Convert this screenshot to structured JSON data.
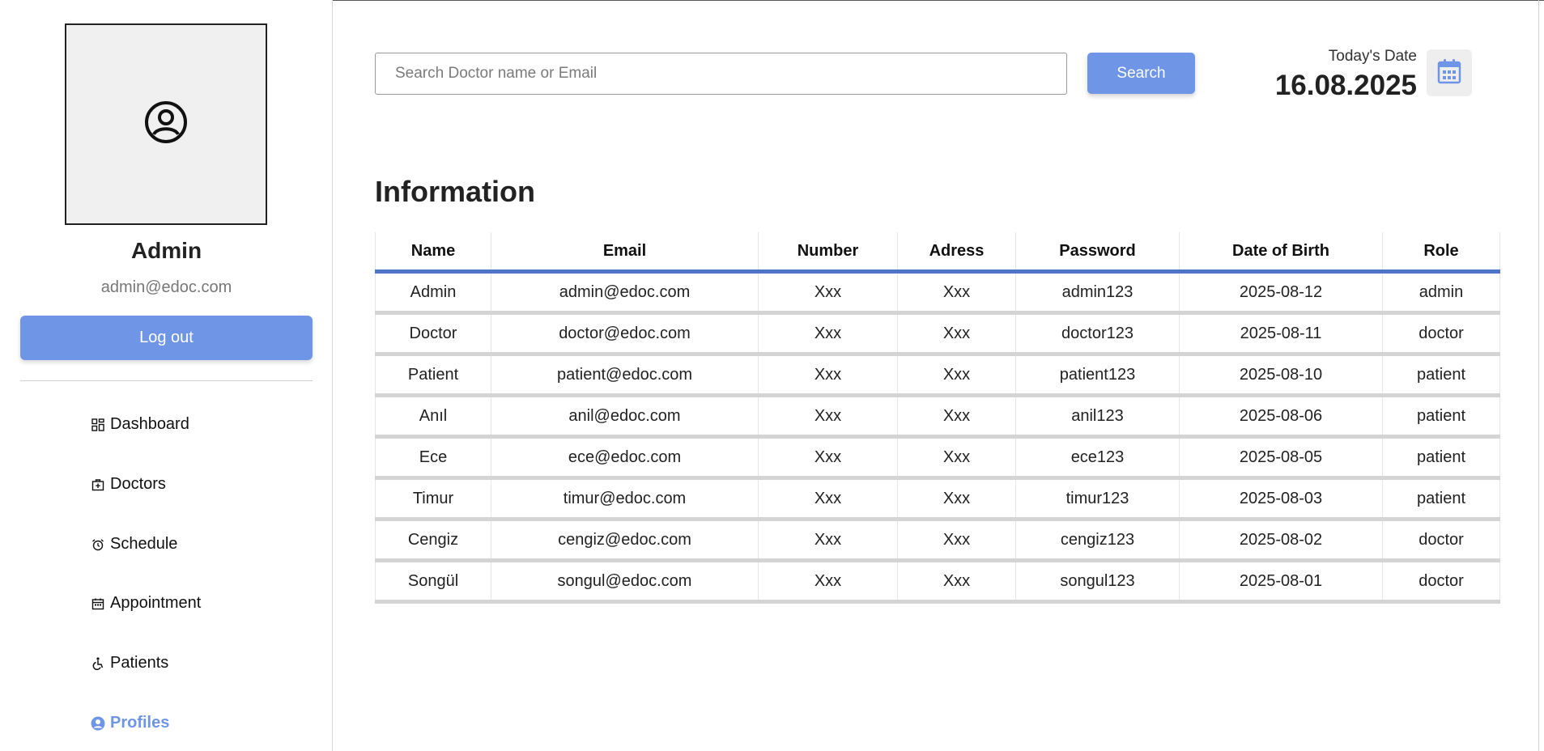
{
  "sidebar": {
    "profile": {
      "avatar_icon": "user-circle-icon",
      "name": "Admin",
      "email": "admin@edoc.com"
    },
    "logout_label": "Log out",
    "nav": [
      {
        "label": "Dashboard",
        "icon": "dashboard-icon"
      },
      {
        "label": "Doctors",
        "icon": "doctor-bag-icon"
      },
      {
        "label": "Schedule",
        "icon": "alarm-clock-icon"
      },
      {
        "label": "Appointment",
        "icon": "calendar-icon"
      },
      {
        "label": "Patients",
        "icon": "wheelchair-icon"
      },
      {
        "label": "Profiles",
        "icon": "user-circle-icon",
        "active": true
      }
    ]
  },
  "header": {
    "search_placeholder": "Search Doctor name or Email",
    "search_label": "Search",
    "date_label": "Today's Date",
    "date_value": "16.08.2025"
  },
  "main": {
    "title": "Information",
    "table": {
      "columns": [
        "Name",
        "Email",
        "Number",
        "Adress",
        "Password",
        "Date of Birth",
        "Role"
      ],
      "rows": [
        [
          "Admin",
          "admin@edoc.com",
          "Xxx",
          "Xxx",
          "admin123",
          "2025-08-12",
          "admin"
        ],
        [
          "Doctor",
          "doctor@edoc.com",
          "Xxx",
          "Xxx",
          "doctor123",
          "2025-08-11",
          "doctor"
        ],
        [
          "Patient",
          "patient@edoc.com",
          "Xxx",
          "Xxx",
          "patient123",
          "2025-08-10",
          "patient"
        ],
        [
          "Anıl",
          "anil@edoc.com",
          "Xxx",
          "Xxx",
          "anil123",
          "2025-08-06",
          "patient"
        ],
        [
          "Ece",
          "ece@edoc.com",
          "Xxx",
          "Xxx",
          "ece123",
          "2025-08-05",
          "patient"
        ],
        [
          "Timur",
          "timur@edoc.com",
          "Xxx",
          "Xxx",
          "timur123",
          "2025-08-03",
          "patient"
        ],
        [
          "Cengiz",
          "cengiz@edoc.com",
          "Xxx",
          "Xxx",
          "cengiz123",
          "2025-08-02",
          "doctor"
        ],
        [
          "Songül",
          "songul@edoc.com",
          "Xxx",
          "Xxx",
          "songul123",
          "2025-08-01",
          "doctor"
        ]
      ]
    }
  },
  "colors": {
    "accent": "#6f95e6",
    "table_header_border": "#4f76c6",
    "row_separator": "#d4d4d4"
  }
}
